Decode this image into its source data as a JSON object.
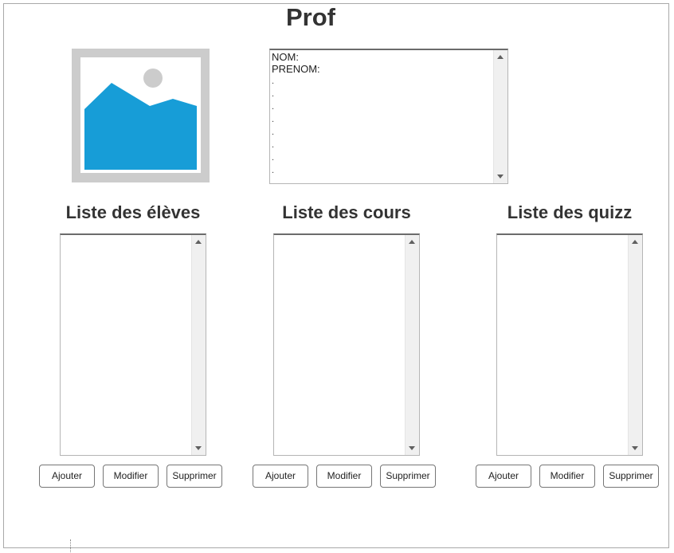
{
  "page": {
    "title": "Prof"
  },
  "profile": {
    "nom_label": "NOM:",
    "prenom_label": "PRENOM:",
    "dots": [
      ".",
      ".",
      ".",
      ".",
      ".",
      ".",
      ".",
      "."
    ]
  },
  "columns": [
    {
      "title": "Liste des élèves",
      "buttons": [
        "Ajouter",
        "Modifier",
        "Supprimer"
      ]
    },
    {
      "title": "Liste des cours",
      "buttons": [
        "Ajouter",
        "Modifier",
        "Supprimer"
      ]
    },
    {
      "title": "Liste des quizz",
      "buttons": [
        "Ajouter",
        "Modifier",
        "Supprimer"
      ]
    }
  ],
  "colors": {
    "image_blue": "#179dd7",
    "image_gray": "#cccccc"
  },
  "icons": [
    "image-placeholder-icon",
    "scroll-up-arrow-icon",
    "scroll-down-arrow-icon"
  ]
}
